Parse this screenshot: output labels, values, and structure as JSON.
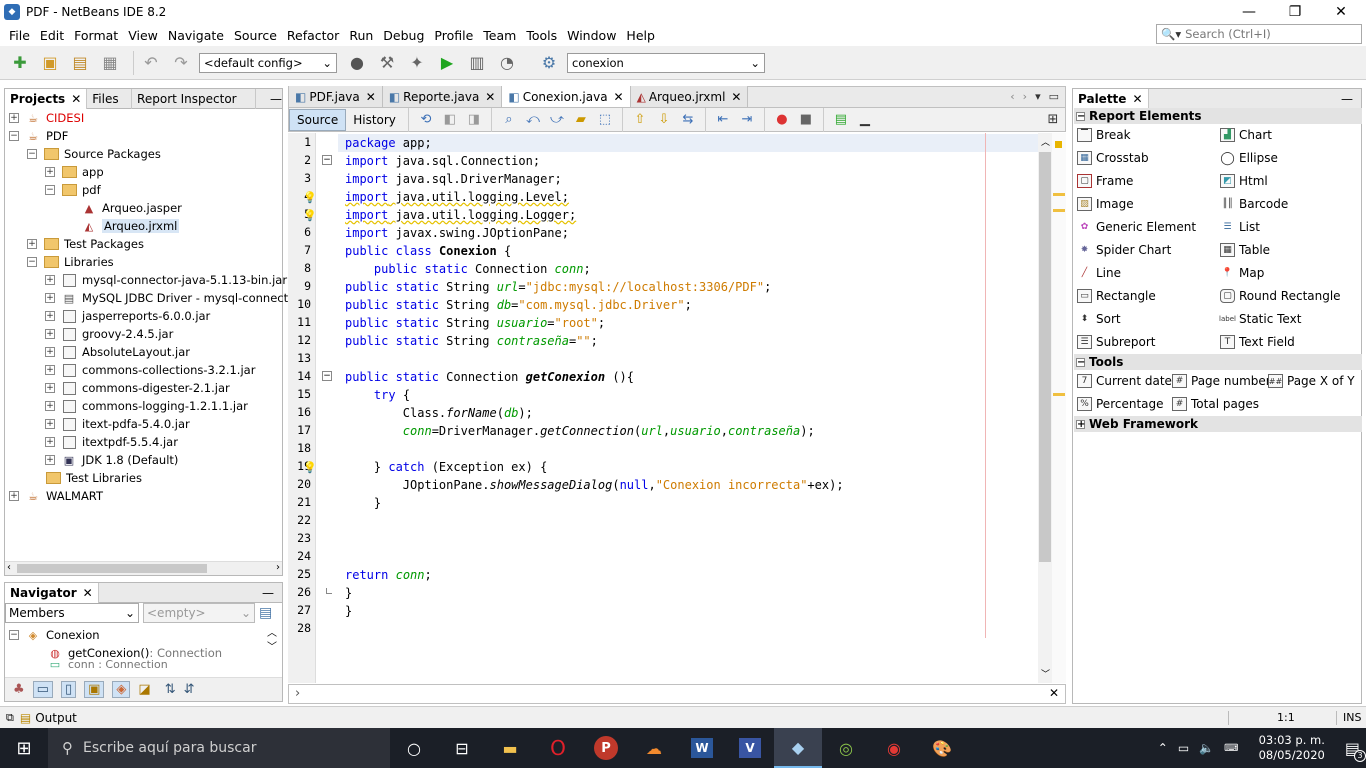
{
  "window": {
    "title": "PDF - NetBeans IDE 8.2",
    "minimize": "—",
    "maximize": "❐",
    "close": "✕"
  },
  "menu": [
    "File",
    "Edit",
    "Format",
    "View",
    "Navigate",
    "Source",
    "Refactor",
    "Run",
    "Debug",
    "Profile",
    "Team",
    "Tools",
    "Window",
    "Help"
  ],
  "search": {
    "placeholder": "Search (Ctrl+I)"
  },
  "toolbar": {
    "config": "<default config>",
    "project_combo": "conexion"
  },
  "projects_panel": {
    "tabs": [
      "Projects",
      "Files",
      "Report Inspector"
    ],
    "tree": [
      {
        "label": "CIDESI",
        "red": true
      },
      {
        "label": "PDF"
      },
      {
        "label": "Source Packages"
      },
      {
        "label": "app"
      },
      {
        "label": "pdf"
      },
      {
        "label": "Arqueo.jasper"
      },
      {
        "label": "Arqueo.jrxml",
        "selected": true
      },
      {
        "label": "Test Packages"
      },
      {
        "label": "Libraries"
      },
      {
        "label": "mysql-connector-java-5.1.13-bin.jar"
      },
      {
        "label": "MySQL JDBC Driver - mysql-connector-ja"
      },
      {
        "label": "jasperreports-6.0.0.jar"
      },
      {
        "label": "groovy-2.4.5.jar"
      },
      {
        "label": "AbsoluteLayout.jar"
      },
      {
        "label": "commons-collections-3.2.1.jar"
      },
      {
        "label": "commons-digester-2.1.jar"
      },
      {
        "label": "commons-logging-1.2.1.1.jar"
      },
      {
        "label": "itext-pdfa-5.4.0.jar"
      },
      {
        "label": "itextpdf-5.5.4.jar"
      },
      {
        "label": "JDK 1.8 (Default)"
      },
      {
        "label": "Test Libraries"
      },
      {
        "label": "WALMART"
      }
    ]
  },
  "navigator": {
    "title": "Navigator",
    "members_combo": "Members",
    "filter_combo": "<empty>",
    "items": [
      {
        "label": "Conexion"
      },
      {
        "label": "getConexion() : Connection",
        "name": "getConexion()",
        "type": " : Connection"
      },
      {
        "label": "conn : Connection"
      }
    ]
  },
  "editor": {
    "tabs": [
      {
        "label": "PDF.java"
      },
      {
        "label": "Reporte.java"
      },
      {
        "label": "Conexion.java",
        "active": true
      },
      {
        "label": "Arqueo.jrxml"
      }
    ],
    "source_tab": "Source",
    "history_tab": "History",
    "line_numbers": [
      "1",
      "2",
      "3",
      "4",
      "5",
      "6",
      "7",
      "8",
      "9",
      "10",
      "11",
      "12",
      "13",
      "14",
      "15",
      "16",
      "17",
      "18",
      "19",
      "20",
      "21",
      "22",
      "23",
      "24",
      "25",
      "26",
      "27",
      "28"
    ]
  },
  "palette": {
    "title": "Palette",
    "sections": [
      {
        "name": "Report Elements",
        "items": [
          [
            "Break",
            "Chart"
          ],
          [
            "Crosstab",
            "Ellipse"
          ],
          [
            "Frame",
            "Html"
          ],
          [
            "Image",
            "Barcode"
          ],
          [
            "Generic Element",
            "List"
          ],
          [
            "Spider Chart",
            "Table"
          ],
          [
            "Line",
            "Map"
          ],
          [
            "Rectangle",
            "Round Rectangle"
          ],
          [
            "Sort",
            "Static Text"
          ],
          [
            "Subreport",
            "Text Field"
          ]
        ]
      },
      {
        "name": "Tools",
        "items": [
          "Current date",
          "Page number",
          "Page X of Y",
          "Percentage",
          "Total pages"
        ]
      },
      {
        "name": "Web Framework"
      }
    ]
  },
  "status": {
    "output": "Output",
    "position": "1:1",
    "mode": "INS"
  },
  "taskbar": {
    "search_placeholder": "Escribe aquí para buscar",
    "time": "03:03 p. m.",
    "date": "08/05/2020",
    "notifications": "3"
  }
}
